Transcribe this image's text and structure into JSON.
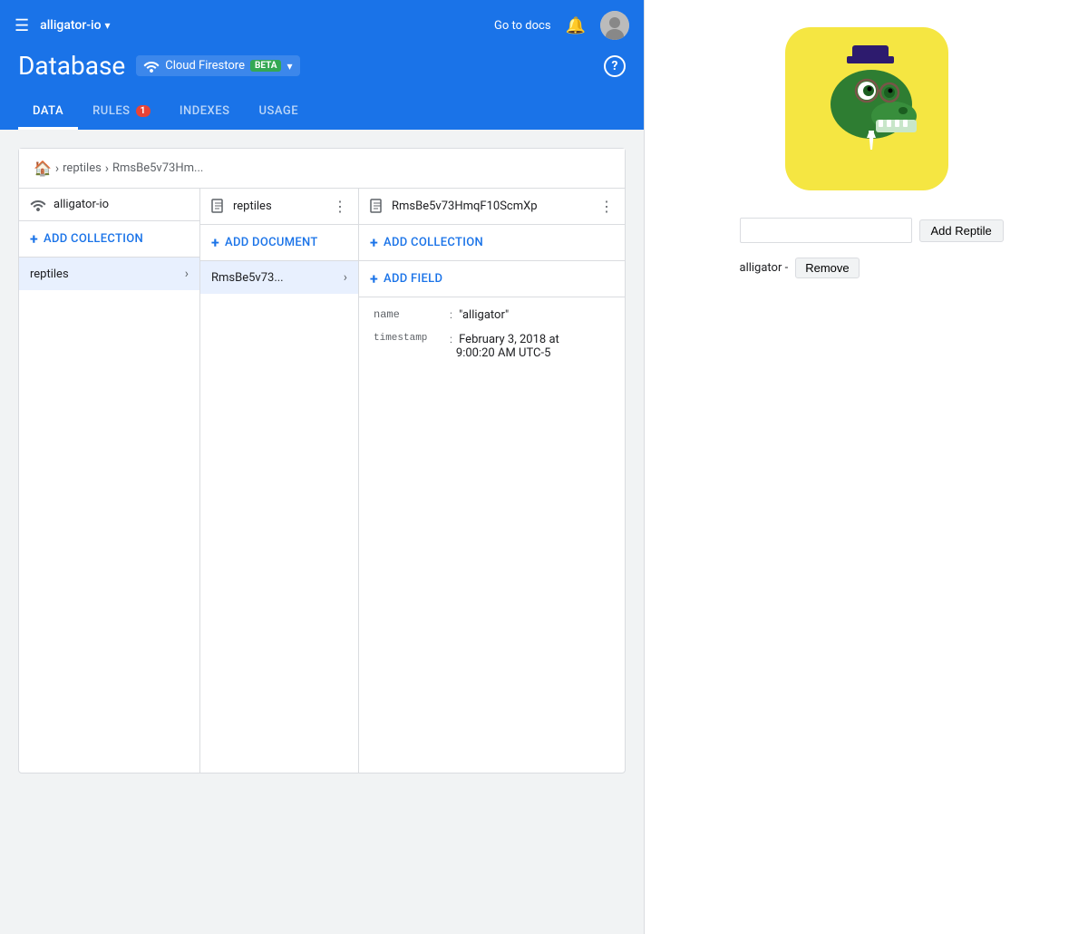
{
  "header": {
    "hamburger": "☰",
    "project_name": "alligator-io",
    "dropdown_arrow": "▾",
    "go_to_docs": "Go to docs",
    "bell": "🔔",
    "page_title": "Database",
    "service": "Cloud Firestore",
    "beta_label": "BETA",
    "help": "?"
  },
  "tabs": [
    {
      "id": "data",
      "label": "DATA",
      "active": true,
      "badge": null
    },
    {
      "id": "rules",
      "label": "RULES",
      "active": false,
      "badge": "1"
    },
    {
      "id": "indexes",
      "label": "INDEXES",
      "active": false,
      "badge": null
    },
    {
      "id": "usage",
      "label": "USAGE",
      "active": false,
      "badge": null
    }
  ],
  "breadcrumb": {
    "home": "🏠",
    "items": [
      "reptiles",
      "RmsBe5v73Hm..."
    ]
  },
  "columns": {
    "col1": {
      "icon": "wifi",
      "name": "alligator-io",
      "add_label": "ADD COLLECTION",
      "rows": [
        {
          "text": "reptiles",
          "active": true
        }
      ]
    },
    "col2": {
      "icon": "doc",
      "name": "reptiles",
      "add_label": "ADD DOCUMENT",
      "rows": [
        {
          "text": "RmsBe5v73...",
          "active": true
        }
      ]
    },
    "col3": {
      "icon": "doc2",
      "name": "RmsBe5v73HmqF10ScmXp",
      "add_collection_label": "ADD COLLECTION",
      "add_field_label": "ADD FIELD",
      "fields": [
        {
          "key": "name",
          "sep": ":",
          "value": "\"alligator\""
        },
        {
          "key": "timestamp",
          "sep": ":",
          "value": "February 3, 2018 at\n9:00:20 AM UTC-5"
        }
      ]
    }
  },
  "right_panel": {
    "reptile_input_placeholder": "",
    "add_reptile_label": "Add Reptile",
    "alligator_label": "alligator -",
    "remove_label": "Remove"
  }
}
